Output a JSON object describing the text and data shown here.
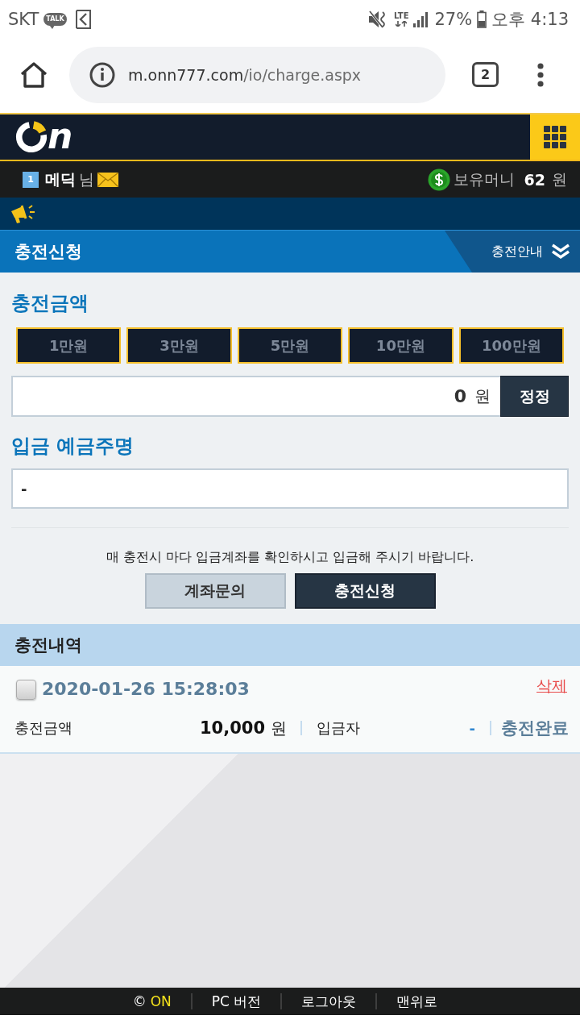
{
  "status_bar": {
    "carrier": "SKT",
    "talk_badge": "TALK",
    "network": "LTE",
    "battery_percent": "27%",
    "time": "오후 4:13"
  },
  "browser": {
    "url_host": "m.onn777.com",
    "url_path": "/io/charge.aspx",
    "tab_count": "2"
  },
  "header": {
    "logo_text": "n"
  },
  "user_bar": {
    "level": "1",
    "nickname": "메딕",
    "honorific": "님",
    "balance_label": "보유머니",
    "balance": "62",
    "currency": "원"
  },
  "title_bar": {
    "title": "충전신청",
    "guide_label": "충전안내"
  },
  "charge_form": {
    "amount_heading": "충전금액",
    "quick_amounts": [
      {
        "label": "1만원"
      },
      {
        "label": "3만원"
      },
      {
        "label": "5만원"
      },
      {
        "label": "10만원"
      },
      {
        "label": "100만원"
      }
    ],
    "amount_value": "0",
    "amount_unit": "원",
    "reset_button": "정정",
    "depositor_heading": "입금 예금주명",
    "depositor_value": "-",
    "notice": "매 충전시 마다 입금계좌를 확인하시고 입금해 주시기 바랍니다.",
    "buttons": [
      {
        "label": "계좌문의",
        "kind": "secondary"
      },
      {
        "label": "충전신청",
        "kind": "primary"
      }
    ]
  },
  "history": {
    "heading": "충전내역",
    "records": [
      {
        "checked": false,
        "datetime": "2020-01-26 15:28:03",
        "delete_label": "삭제",
        "amount_label": "충전금액",
        "amount": "10,000",
        "amount_unit": "원",
        "depositor_label": "입금자",
        "depositor": "-",
        "status": "충전완료"
      }
    ]
  },
  "footer": {
    "copyright_symbol": "©",
    "brand": "ON",
    "links": [
      "PC 버전",
      "로그아웃",
      "맨위로"
    ]
  }
}
